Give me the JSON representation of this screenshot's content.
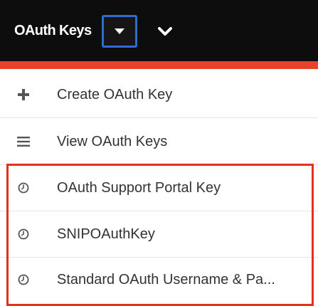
{
  "header": {
    "module_label": "OAuth Keys"
  },
  "menu": {
    "items": [
      {
        "label": "Create OAuth Key",
        "icon": "plus-icon"
      },
      {
        "label": "View OAuth Keys",
        "icon": "list-icon"
      },
      {
        "label": "OAuth Support Portal Key",
        "icon": "clock-icon"
      },
      {
        "label": "SNIPOAuthKey",
        "icon": "clock-icon"
      },
      {
        "label": "Standard OAuth Username & Pa...",
        "icon": "clock-icon"
      }
    ]
  },
  "colors": {
    "topbar": "#0d0d0d",
    "accent": "#e8412c",
    "focus_border": "#2d6bd6",
    "highlight": "#e0321f"
  }
}
